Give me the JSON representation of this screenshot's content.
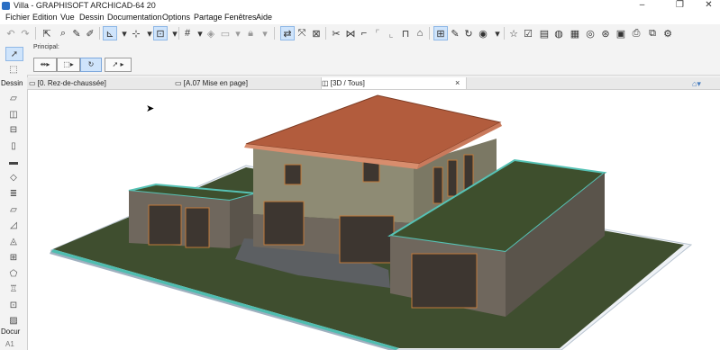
{
  "window": {
    "title": "Villa - GRAPHISOFT ARCHICAD-64 20"
  },
  "menu": [
    "Fichier",
    "Edition",
    "Vue",
    "Dessin",
    "Documentation",
    "Options",
    "Partage",
    "Fenêtres",
    "Aide"
  ],
  "infobox": {
    "label": "Principal:"
  },
  "toolbox": {
    "section_dessin": "Dessin",
    "section_docu": "Docur",
    "bottom_label": "A1"
  },
  "tabs": [
    {
      "label": "[0. Rez-de-chaussée]",
      "active": false
    },
    {
      "label": "[A.07 Mise en page]",
      "active": false
    },
    {
      "label": "[3D / Tous]",
      "active": true
    }
  ],
  "tab_close": "×",
  "colors": {
    "accent": "#2b6fc4",
    "selected_tool": "#cfe4fb",
    "roof": "#b25c3d",
    "grass": "#3f4e2f",
    "terrace": "#56c2b5"
  }
}
